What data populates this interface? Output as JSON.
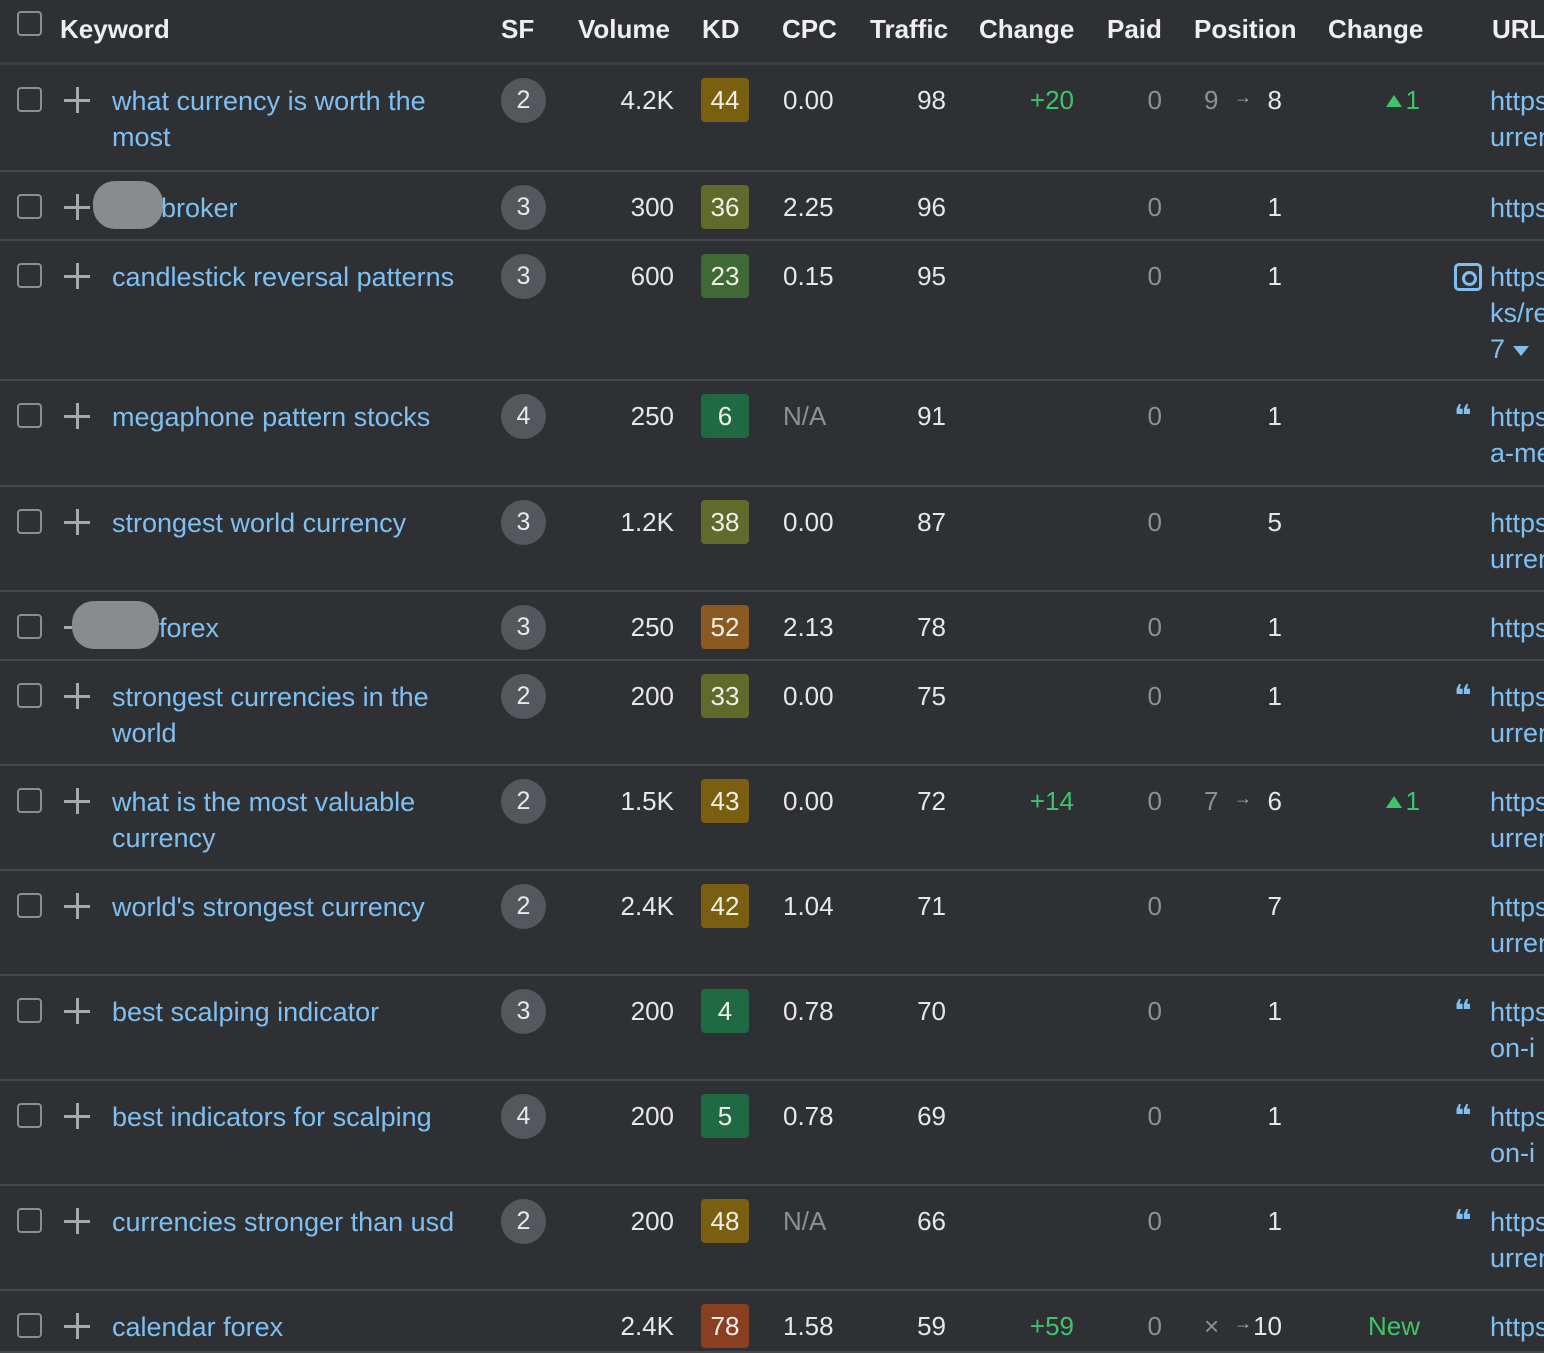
{
  "header": {
    "keyword": "Keyword",
    "sf": "SF",
    "volume": "Volume",
    "kd": "KD",
    "cpc": "CPC",
    "traffic": "Traffic",
    "change": "Change",
    "paid": "Paid",
    "position": "Position",
    "position_change": "Change",
    "url": "URL"
  },
  "kd_colors": {
    "hard": "#7a5f10",
    "medium": "#5f6a2b",
    "low_medium": "#3f6a35",
    "easy": "#1f6a43",
    "orange": "#8a5a22",
    "red": "#8a3f22"
  },
  "accent_link": "#7ec0f2",
  "positive_green": "#3ec56b",
  "rows": [
    {
      "keyword": "what currency is worth the most",
      "sf": "2",
      "volume": "4.2K",
      "kd": "44",
      "cpc": "0.00",
      "traffic": "98",
      "change": "+20",
      "paid": "0",
      "pos_from": "9",
      "pos_arrow": "→",
      "position": "8",
      "pos_change": "1",
      "url": "https\nurren",
      "url_icon": ""
    },
    {
      "keyword": "broker",
      "sf": "3",
      "volume": "300",
      "kd": "36",
      "cpc": "2.25",
      "traffic": "96",
      "change": "",
      "paid": "0",
      "pos_from": "",
      "pos_arrow": "",
      "position": "1",
      "pos_change": "",
      "url": "https",
      "url_icon": ""
    },
    {
      "keyword": "candlestick reversal patterns",
      "sf": "3",
      "volume": "600",
      "kd": "23",
      "cpc": "0.15",
      "traffic": "95",
      "change": "",
      "paid": "0",
      "pos_from": "",
      "pos_arrow": "",
      "position": "1",
      "pos_change": "",
      "url": "https\nks/re\n7",
      "url_icon": "image-icon"
    },
    {
      "keyword": "megaphone pattern stocks",
      "sf": "4",
      "volume": "250",
      "kd": "6",
      "cpc": "N/A",
      "traffic": "91",
      "change": "",
      "paid": "0",
      "pos_from": "",
      "pos_arrow": "",
      "position": "1",
      "pos_change": "",
      "url": "https\na-me",
      "url_icon": "quote-icon"
    },
    {
      "keyword": "strongest world currency",
      "sf": "3",
      "volume": "1.2K",
      "kd": "38",
      "cpc": "0.00",
      "traffic": "87",
      "change": "",
      "paid": "0",
      "pos_from": "",
      "pos_arrow": "",
      "position": "5",
      "pos_change": "",
      "url": "https\nurren",
      "url_icon": ""
    },
    {
      "keyword": "forex",
      "sf": "3",
      "volume": "250",
      "kd": "52",
      "cpc": "2.13",
      "traffic": "78",
      "change": "",
      "paid": "0",
      "pos_from": "",
      "pos_arrow": "",
      "position": "1",
      "pos_change": "",
      "url": "https",
      "url_icon": ""
    },
    {
      "keyword": "strongest currencies in the world",
      "sf": "2",
      "volume": "200",
      "kd": "33",
      "cpc": "0.00",
      "traffic": "75",
      "change": "",
      "paid": "0",
      "pos_from": "",
      "pos_arrow": "",
      "position": "1",
      "pos_change": "",
      "url": "https\nurren",
      "url_icon": "quote-icon"
    },
    {
      "keyword": "what is the most valuable currency",
      "sf": "2",
      "volume": "1.5K",
      "kd": "43",
      "cpc": "0.00",
      "traffic": "72",
      "change": "+14",
      "paid": "0",
      "pos_from": "7",
      "pos_arrow": "→",
      "position": "6",
      "pos_change": "1",
      "url": "https\nurren",
      "url_icon": ""
    },
    {
      "keyword": "world's strongest currency",
      "sf": "2",
      "volume": "2.4K",
      "kd": "42",
      "cpc": "1.04",
      "traffic": "71",
      "change": "",
      "paid": "0",
      "pos_from": "",
      "pos_arrow": "",
      "position": "7",
      "pos_change": "",
      "url": "https\nurren",
      "url_icon": ""
    },
    {
      "keyword": "best scalping indicator",
      "sf": "3",
      "volume": "200",
      "kd": "4",
      "cpc": "0.78",
      "traffic": "70",
      "change": "",
      "paid": "0",
      "pos_from": "",
      "pos_arrow": "",
      "position": "1",
      "pos_change": "",
      "url": "https\non-i",
      "url_icon": "quote-icon"
    },
    {
      "keyword": "best indicators for scalping",
      "sf": "4",
      "volume": "200",
      "kd": "5",
      "cpc": "0.78",
      "traffic": "69",
      "change": "",
      "paid": "0",
      "pos_from": "",
      "pos_arrow": "",
      "position": "1",
      "pos_change": "",
      "url": "https\non-i",
      "url_icon": "quote-icon"
    },
    {
      "keyword": "currencies stronger than usd",
      "sf": "2",
      "volume": "200",
      "kd": "48",
      "cpc": "N/A",
      "traffic": "66",
      "change": "",
      "paid": "0",
      "pos_from": "",
      "pos_arrow": "",
      "position": "1",
      "pos_change": "",
      "url": "https\nurren",
      "url_icon": "quote-icon"
    },
    {
      "keyword": "calendar forex",
      "sf": "",
      "volume": "2.4K",
      "kd": "78",
      "cpc": "1.58",
      "traffic": "59",
      "change": "+59",
      "paid": "0",
      "pos_from": "×",
      "pos_arrow": "→",
      "position": "10",
      "pos_change": "New",
      "url": "https",
      "url_icon": ""
    }
  ]
}
